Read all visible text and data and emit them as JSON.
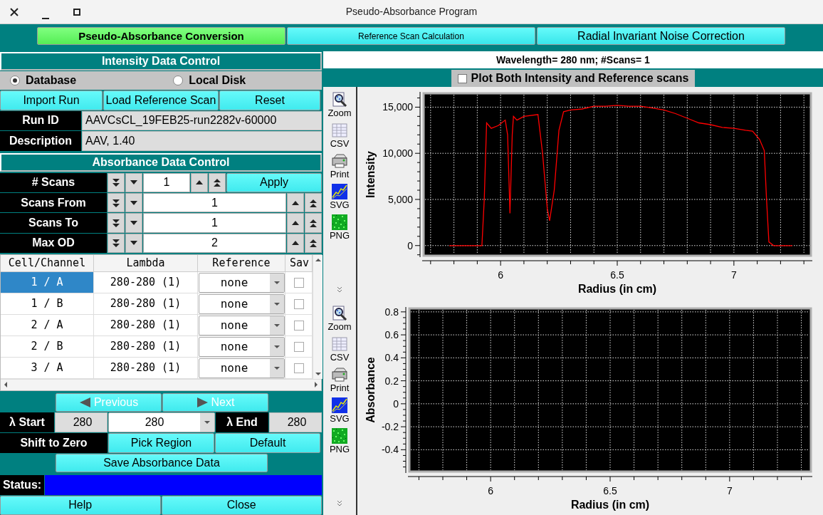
{
  "window": {
    "title": "Pseudo-Absorbance Program"
  },
  "tabs": [
    {
      "label": "Pseudo-Absorbance Conversion",
      "selected": true
    },
    {
      "label": "Reference Scan Calculation",
      "selected": false
    },
    {
      "label": "Radial Invariant Noise Correction",
      "selected": false
    }
  ],
  "intensity_panel": {
    "title": "Intensity Data Control",
    "sources": [
      {
        "label": "Database",
        "selected": true
      },
      {
        "label": "Local Disk",
        "selected": false
      }
    ],
    "buttons": [
      "Import Run",
      "Load Reference Scan",
      "Reset"
    ],
    "fields": [
      {
        "label": "Run ID",
        "value": "AAVCsCL_19FEB25-run2282v-60000"
      },
      {
        "label": "Description",
        "value": "AAV, 1.40"
      }
    ]
  },
  "absorbance_panel": {
    "title": "Absorbance Data Control",
    "counters": [
      {
        "label": "# Scans",
        "value": "1",
        "kind": "short"
      },
      {
        "label": "Scans From",
        "value": "1",
        "kind": "wide"
      },
      {
        "label": "Scans To",
        "value": "1",
        "kind": "wide"
      },
      {
        "label": "Max OD",
        "value": "2",
        "kind": "wide"
      }
    ],
    "apply_button": "Apply",
    "table": {
      "columns": [
        "Cell/Channel",
        "Lambda",
        "Reference",
        "Sav"
      ],
      "rows": [
        {
          "cell": "1 / A",
          "lambda": "280-280 (1)",
          "reference": "none",
          "saved": false,
          "selected": true
        },
        {
          "cell": "1 / B",
          "lambda": "280-280 (1)",
          "reference": "none",
          "saved": false,
          "selected": false
        },
        {
          "cell": "2 / A",
          "lambda": "280-280 (1)",
          "reference": "none",
          "saved": false,
          "selected": false
        },
        {
          "cell": "2 / B",
          "lambda": "280-280 (1)",
          "reference": "none",
          "saved": false,
          "selected": false
        },
        {
          "cell": "3 / A",
          "lambda": "280-280 (1)",
          "reference": "none",
          "saved": false,
          "selected": false
        }
      ]
    },
    "nav_buttons": [
      {
        "label": "Previous",
        "kind": "previous",
        "disabled": true
      },
      {
        "label": "Next",
        "kind": "next",
        "disabled": true
      }
    ],
    "lambda_start": {
      "label": "λ Start",
      "value": "280"
    },
    "lambda_select": "280",
    "lambda_end": {
      "label": "λ End",
      "value": "280"
    },
    "shift_label": "Shift to Zero",
    "shift_buttons": [
      "Pick Region",
      "Default"
    ],
    "save_button": "Save Absorbance Data",
    "status": {
      "label": "Status:"
    },
    "bottom_buttons": [
      "Help",
      "Close"
    ]
  },
  "plot_panel": {
    "header": "Wavelength= 280 nm; #Scans= 1",
    "plot_both": {
      "label": "Plot Both Intensity and Reference scans",
      "checked": false
    },
    "plots": [
      {
        "tools": [
          {
            "label": "Zoom",
            "kind": "zoom"
          },
          {
            "label": "CSV",
            "kind": "csv"
          },
          {
            "label": "Print",
            "kind": "print"
          },
          {
            "label": "SVG",
            "kind": "svg"
          },
          {
            "label": "PNG",
            "kind": "png"
          }
        ],
        "chart_data": {
          "type": "line",
          "xlabel": "Radius (in cm)",
          "ylabel": "Intensity",
          "xlim": [
            5.67,
            7.33
          ],
          "ylim": [
            -1100,
            16500
          ],
          "xticks": [
            6,
            6.5,
            7
          ],
          "yticks": [
            {
              "value": 0,
              "label": "0"
            },
            {
              "value": 5000,
              "label": "5,000"
            },
            {
              "value": 10000,
              "label": "10,000"
            },
            {
              "value": 15000,
              "label": "15,000"
            }
          ],
          "x": [
            5.78,
            5.92,
            5.93,
            5.94,
            5.96,
            5.99,
            6.02,
            6.03,
            6.04,
            6.05,
            6.055,
            6.07,
            6.1,
            6.16,
            6.18,
            6.2,
            6.21,
            6.23,
            6.25,
            6.27,
            6.3,
            6.35,
            6.4,
            6.45,
            6.5,
            6.55,
            6.6,
            6.65,
            6.7,
            6.75,
            6.8,
            6.85,
            6.9,
            6.95,
            7.0,
            7.05,
            7.08,
            7.11,
            7.13,
            7.14,
            7.15,
            7.17,
            7.25
          ],
          "grid": true,
          "series": [
            {
              "color": "#ff0000",
              "values": [
                0,
                0,
                5000,
                13300,
                12700,
                13000,
                13600,
                12000,
                3500,
                12000,
                14000,
                13600,
                14000,
                14200,
                10000,
                4000,
                2700,
                6000,
                12500,
                14500,
                14700,
                14800,
                15100,
                15100,
                15200,
                15100,
                15100,
                14900,
                14700,
                14300,
                13800,
                13300,
                13100,
                12800,
                12700,
                12500,
                12400,
                11500,
                10300,
                5000,
                400,
                0,
                0
              ]
            }
          ]
        }
      },
      {
        "tools": [
          {
            "label": "Zoom",
            "kind": "zoom"
          },
          {
            "label": "CSV",
            "kind": "csv"
          },
          {
            "label": "Print",
            "kind": "print"
          },
          {
            "label": "SVG",
            "kind": "svg"
          },
          {
            "label": "PNG",
            "kind": "png"
          }
        ],
        "chart_data": {
          "type": "line",
          "xlabel": "Radius (in cm)",
          "ylabel": "Absorbance",
          "grid": true,
          "xlim": [
            5.66,
            7.34
          ],
          "ylim": [
            -0.59,
            0.83
          ],
          "xticks": [
            6,
            6.5,
            7
          ],
          "yticks": [
            0.8,
            0.6,
            0.4,
            0.2,
            0,
            -0.2,
            -0.4
          ]
        }
      }
    ]
  }
}
